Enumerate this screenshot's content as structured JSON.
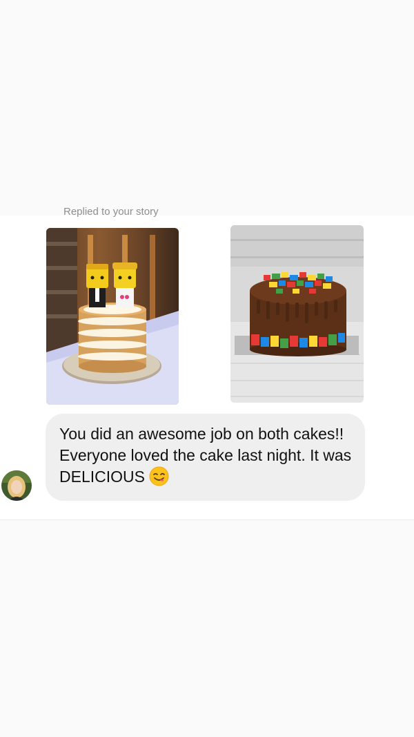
{
  "chat": {
    "reply_label": "Replied to your story",
    "message": "You did an awesome job on both cakes!! Everyone loved the cake last night. It was DELICIOUS",
    "emoji": "face-savoring-food"
  },
  "attachments": [
    {
      "name": "naked-cake-with-lego-bride-and-groom-topper"
    },
    {
      "name": "chocolate-drip-cake-with-lego-bricks"
    }
  ],
  "colors": {
    "bubble": "#efefef",
    "background": "#fafafa",
    "reply_label": "#8e8e8e"
  }
}
